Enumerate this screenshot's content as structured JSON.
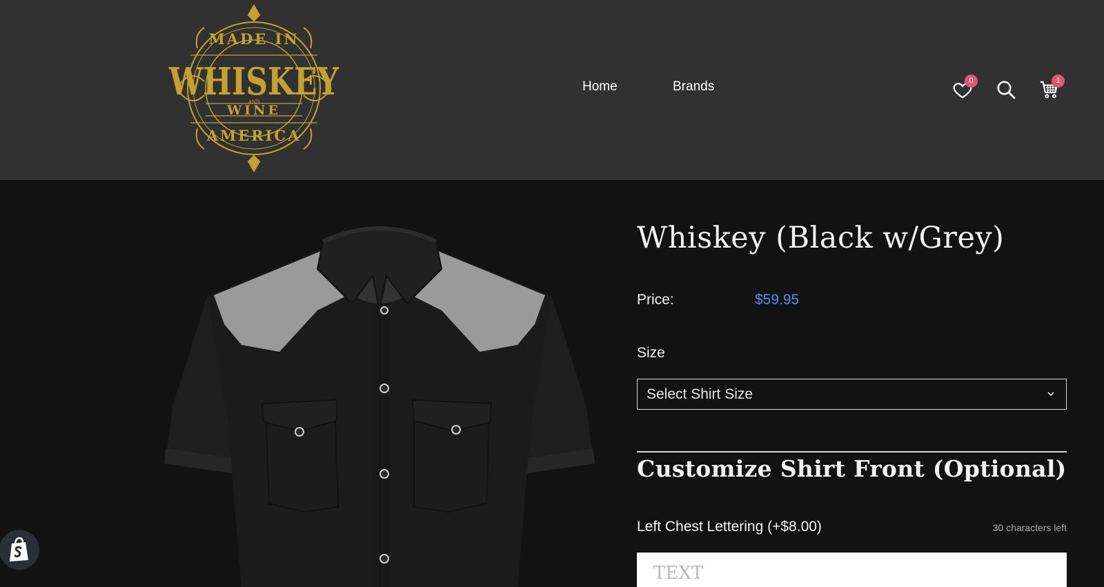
{
  "header": {
    "logo": {
      "line1": "MADE IN",
      "line2": "WHISKEY",
      "line3": "AND",
      "line4": "WINE",
      "line5": "AMERICA",
      "color": "#c3a230"
    },
    "nav": [
      {
        "label": "Home"
      },
      {
        "label": "Brands"
      }
    ],
    "icons": {
      "wishlist_icon": "heart-icon",
      "wishlist_count": "0",
      "search_icon": "search-icon",
      "cart_icon": "cart-icon",
      "cart_count": "1",
      "badge_color": "#e05579"
    },
    "background": "#313131"
  },
  "product": {
    "title": "Whiskey (Black w/Grey)",
    "price_label": "Price:",
    "price": "$59.95",
    "price_color": "#4d8ef0",
    "size_label": "Size",
    "size_select": "Select Shirt Size",
    "customize_title": "Customize Shirt Front (Optional)",
    "lettering_label": "Left Chest Lettering (+$8.00)",
    "chars_left": "30 characters left",
    "lettering_placeholder": "TEXT",
    "image_colors": {
      "body": "#1b1b1b",
      "yoke": "#9a9a9a"
    }
  },
  "shopify_icon": "shopify-bag-icon",
  "background": "#121212"
}
